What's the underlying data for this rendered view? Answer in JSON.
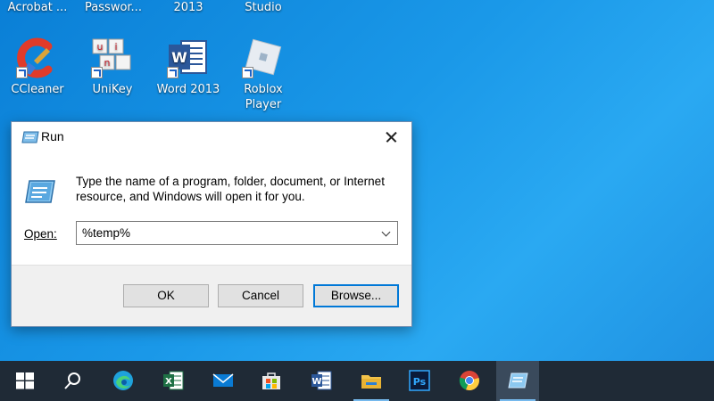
{
  "desktop": {
    "top_row_labels": [
      "Acrobat ...",
      "Passwor...",
      "2013",
      "Studio"
    ],
    "icons": [
      {
        "label": "CCleaner",
        "icon": "ccleaner-icon"
      },
      {
        "label": "UniKey",
        "icon": "unikey-icon"
      },
      {
        "label": "Word 2013",
        "icon": "word-icon"
      },
      {
        "label": "Roblox\nPlayer",
        "icon": "roblox-icon"
      }
    ]
  },
  "run_dialog": {
    "title": "Run",
    "message": "Type the name of a program, folder, document, or Internet resource, and Windows will open it for you.",
    "open_label": "Open:",
    "open_value": "%temp%",
    "buttons": {
      "ok": "OK",
      "cancel": "Cancel",
      "browse": "Browse..."
    }
  },
  "taskbar": {
    "items": [
      "start-icon",
      "search-icon",
      "edge-icon",
      "excel-icon",
      "mail-icon",
      "store-icon",
      "word-icon",
      "file-explorer-icon",
      "photoshop-icon",
      "chrome-icon",
      "run-icon"
    ]
  },
  "colors": {
    "desktop_blue": "#1a98e8",
    "taskbar": "#1f2a36",
    "accent": "#0078d7"
  }
}
